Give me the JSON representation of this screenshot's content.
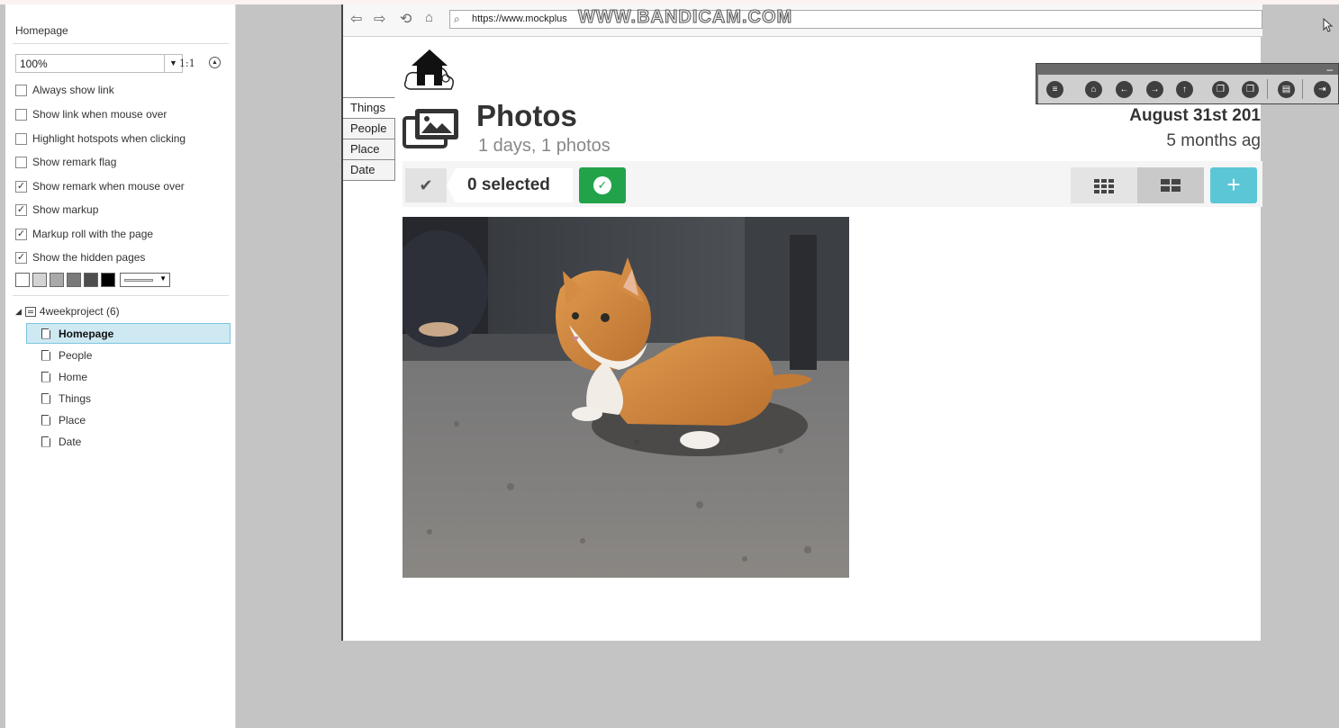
{
  "left_panel": {
    "title": "Homepage",
    "zoom_value": "100%",
    "zoom_ratio": "1:1",
    "options": [
      {
        "label": "Always show link",
        "checked": false
      },
      {
        "label": "Show link when mouse over",
        "checked": false
      },
      {
        "label": "Highlight hotspots when clicking",
        "checked": false
      },
      {
        "label": "Show remark flag",
        "checked": false
      },
      {
        "label": "Show remark when mouse over",
        "checked": true
      },
      {
        "label": "Show markup",
        "checked": true
      },
      {
        "label": "Markup roll with the page",
        "checked": true
      },
      {
        "label": "Show the hidden pages",
        "checked": true
      }
    ],
    "swatch_colors": [
      "#ffffff",
      "#d4d4d4",
      "#a9a9a9",
      "#7a7a7a",
      "#4d4d4d",
      "#000000"
    ],
    "tree": {
      "root_label": "4weekproject (6)",
      "pages": [
        {
          "label": "Homepage",
          "selected": true
        },
        {
          "label": "People",
          "selected": false
        },
        {
          "label": "Home",
          "selected": false
        },
        {
          "label": "Things",
          "selected": false
        },
        {
          "label": "Place",
          "selected": false
        },
        {
          "label": "Date",
          "selected": false
        }
      ]
    }
  },
  "browser": {
    "url": "https://www.mockplus",
    "watermark": "WWW.BANDICAM.COM",
    "nav_icons": [
      "back-icon",
      "forward-icon",
      "refresh-icon",
      "home-icon"
    ]
  },
  "prototype": {
    "side_tabs": [
      "Things",
      "People",
      "Place",
      "Date"
    ],
    "active_tab": "Things",
    "title": "Photos",
    "subtitle": "1 days, 1 photos",
    "date_main": "August 31st 201",
    "date_relative": "5 months ag",
    "selected_label": "0 selected",
    "add_label": "+",
    "colors": {
      "ok": "#22a34a",
      "add": "#5bc7d6"
    }
  },
  "floating_toolbar": {
    "icons": [
      "menu-icon",
      "home-icon",
      "previous-icon",
      "next-icon",
      "upload-icon",
      "copy-icon",
      "paste-icon",
      "note-icon",
      "exit-icon"
    ]
  }
}
